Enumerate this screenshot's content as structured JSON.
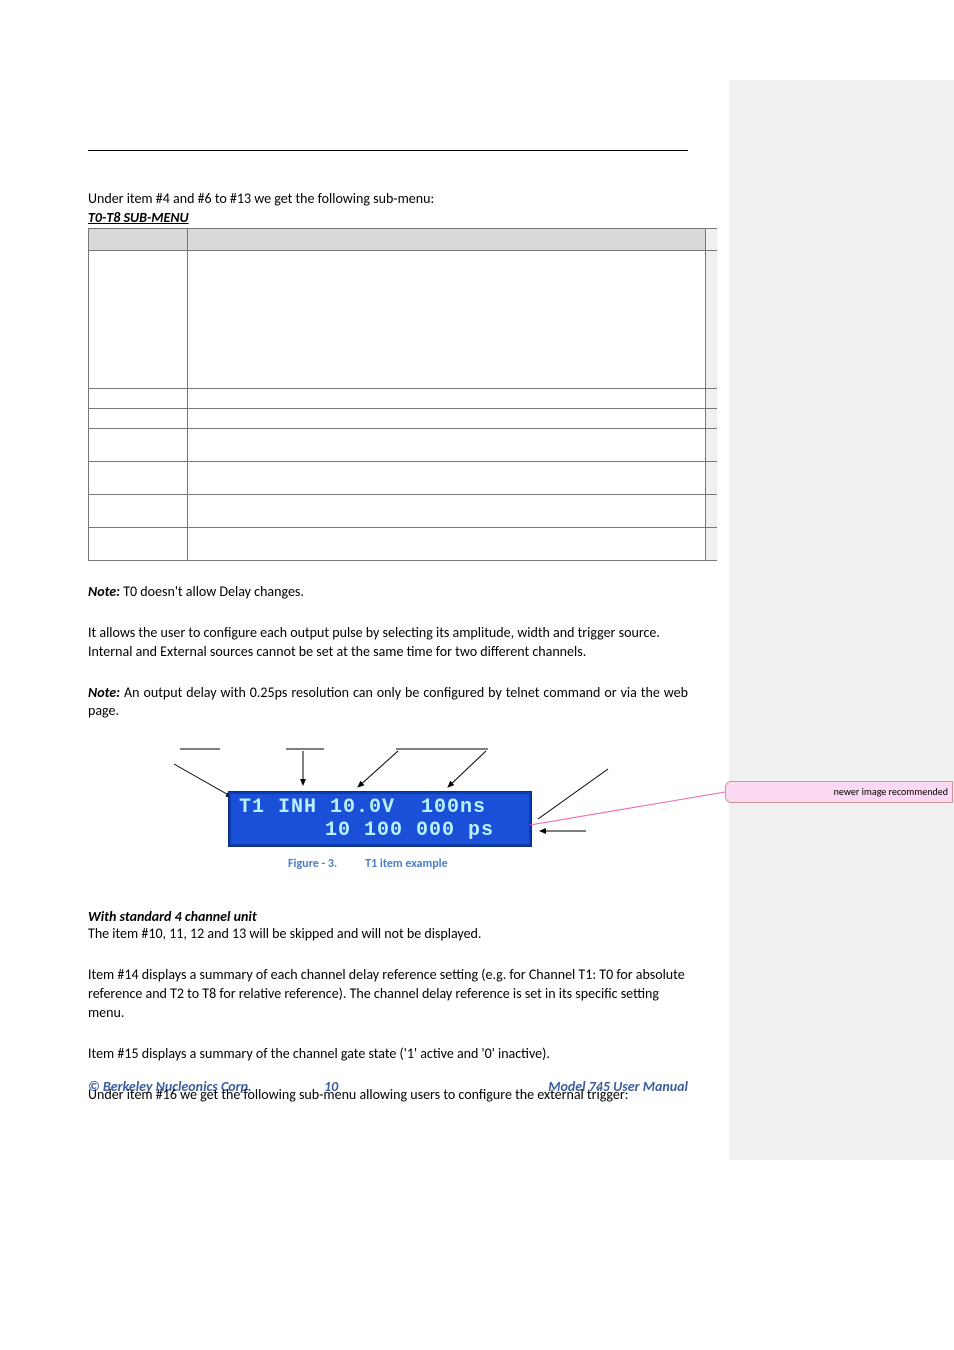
{
  "intro_line": "Under item #4 and #6 to #13 we get the following sub-menu:",
  "submenu_title": "T0-T8 SUB-MENU",
  "note1_label": "Note:",
  "note1_text": " T0 doesn't allow Delay changes.",
  "para1": "It allows the user to configure each output pulse by selecting its amplitude, width and trigger source. Internal and External sources cannot be set at the same time for two different channels.",
  "note2_label": "Note:",
  "note2_text": " An output delay with 0.25ps resolution can only be configured by telnet command or via the web page.",
  "lcd_line1": "T1 INH 10.0V  100ns",
  "lcd_line2": "10 100 000 ps",
  "figure_label_a": "Figure - 3.",
  "figure_label_b": "T1 item example",
  "subhead": "With standard 4 channel unit",
  "para2": "The item #10, 11, 12 and 13 will be skipped and will not be displayed.",
  "para3": "Item #14 displays a summary of each channel delay reference setting (e.g. for Channel T1: T0 for absolute reference and T2 to T8 for relative reference). The channel delay reference is set in its specific setting menu.",
  "para4": "Item #15 displays a summary of the channel gate state ('1' active and '0' inactive).",
  "para5": "Under item #16 we get the following sub-menu allowing users to configure the external trigger:",
  "footer_left": "© Berkeley Nucleonics Corp.",
  "footer_mid": "10",
  "footer_right": "Model 745 User Manual",
  "comment_text": "newer image recommended"
}
